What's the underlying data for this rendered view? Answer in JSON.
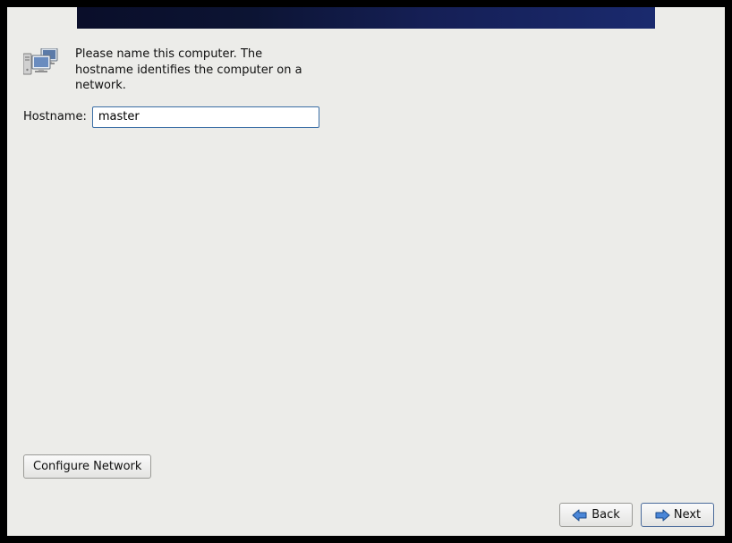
{
  "intro": {
    "text": "Please name this computer.  The hostname identifies the computer on a network."
  },
  "hostname": {
    "label": "Hostname:",
    "value": "master"
  },
  "buttons": {
    "configure_network": "Configure Network",
    "back": "Back",
    "next": "Next"
  }
}
